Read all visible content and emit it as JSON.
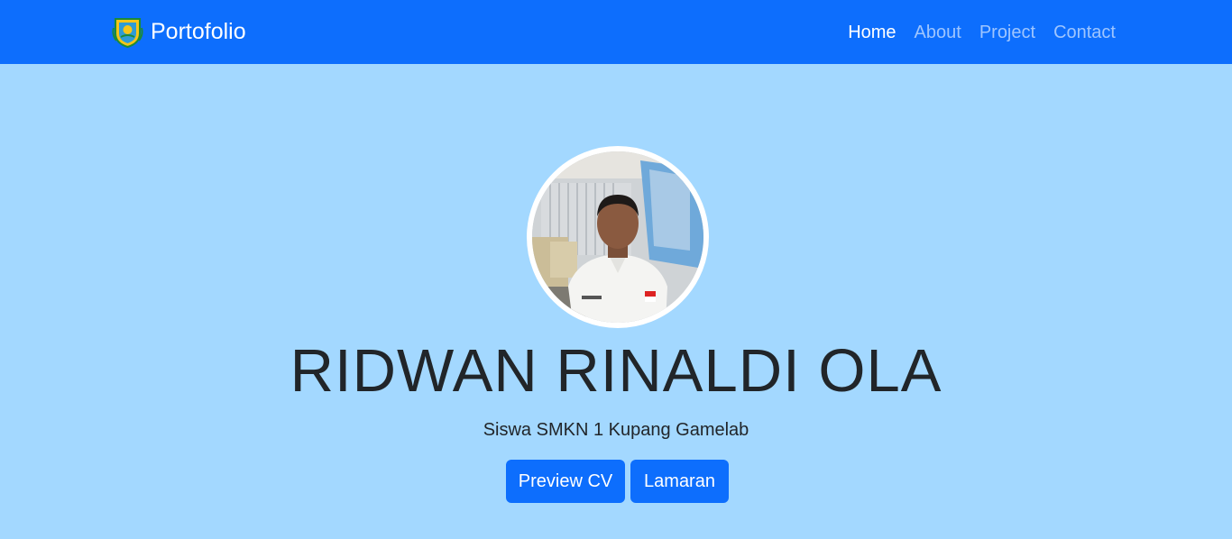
{
  "navbar": {
    "brand": "Portofolio",
    "brand_logo_icon": "crest-logo-icon",
    "links": [
      {
        "label": "Home",
        "active": true
      },
      {
        "label": "About",
        "active": false
      },
      {
        "label": "Project",
        "active": false
      },
      {
        "label": "Contact",
        "active": false
      }
    ]
  },
  "hero": {
    "name": "RIDWAN RINALDI OLA",
    "subtitle": "Siswa SMKN 1 Kupang Gamelab",
    "buttons": {
      "preview_cv": "Preview CV",
      "lamaran": "Lamaran"
    }
  },
  "colors": {
    "navbar_bg": "#0d6efd",
    "page_bg": "#a3d8ff",
    "button_bg": "#0d6efd",
    "text_dark": "#212529"
  }
}
